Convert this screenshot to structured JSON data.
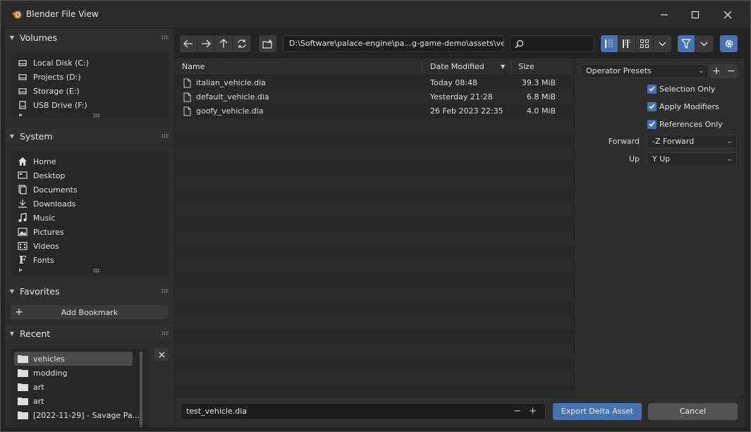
{
  "window": {
    "title": "Blender File View"
  },
  "sidebar": {
    "volumes": {
      "title": "Volumes",
      "items": [
        {
          "label": "Local Disk (C:)",
          "icon": "disk-icon"
        },
        {
          "label": "Projects (D:)",
          "icon": "disk-icon"
        },
        {
          "label": "Storage (E:)",
          "icon": "disk-icon"
        },
        {
          "label": "USB Drive (F:)",
          "icon": "usb-drive-icon"
        }
      ]
    },
    "system": {
      "title": "System",
      "items": [
        {
          "label": "Home",
          "icon": "home-icon"
        },
        {
          "label": "Desktop",
          "icon": "desktop-icon"
        },
        {
          "label": "Documents",
          "icon": "documents-icon"
        },
        {
          "label": "Downloads",
          "icon": "download-icon"
        },
        {
          "label": "Music",
          "icon": "music-icon"
        },
        {
          "label": "Pictures",
          "icon": "pictures-icon"
        },
        {
          "label": "Videos",
          "icon": "videos-icon"
        },
        {
          "label": "Fonts",
          "icon": "font-icon"
        }
      ]
    },
    "favorites": {
      "title": "Favorites",
      "add_bookmark": "Add Bookmark"
    },
    "recent": {
      "title": "Recent",
      "items": [
        {
          "label": "vehicles",
          "selected": true
        },
        {
          "label": "modding",
          "selected": false
        },
        {
          "label": "art",
          "selected": false
        },
        {
          "label": "art",
          "selected": false
        },
        {
          "label": "[2022-11-29] - Savage Pa...",
          "selected": false
        }
      ]
    }
  },
  "toolbar": {
    "path": "D:\\Software\\palace-engine\\pa...g-game-demo\\assets\\vehicles\\",
    "search_placeholder": ""
  },
  "filelist": {
    "columns": {
      "name": "Name",
      "date": "Date Modified",
      "size": "Size"
    },
    "rows": [
      {
        "name": "italian_vehicle.dia",
        "date": "Today 08:48",
        "size": "39.3 MiB"
      },
      {
        "name": "default_vehicle.dia",
        "date": "Yesterday 21:28",
        "size": "6.8 MiB"
      },
      {
        "name": "goofy_vehicle.dia",
        "date": "26 Feb 2023 22:35",
        "size": "4.0 MiB"
      }
    ]
  },
  "options": {
    "presets": "Operator Presets",
    "selection_only": "Selection Only",
    "apply_modifiers": "Apply Modifiers",
    "references_only": "References Only",
    "forward_label": "Forward",
    "forward_value": "-Z Forward",
    "up_label": "Up",
    "up_value": "Y Up"
  },
  "bottom": {
    "filename": "test_vehicle.dia",
    "export_label": "Export Delta Asset",
    "cancel_label": "Cancel"
  },
  "colors": {
    "accent": "#4772b3",
    "background": "#232323",
    "panel": "#2e2e2e"
  }
}
